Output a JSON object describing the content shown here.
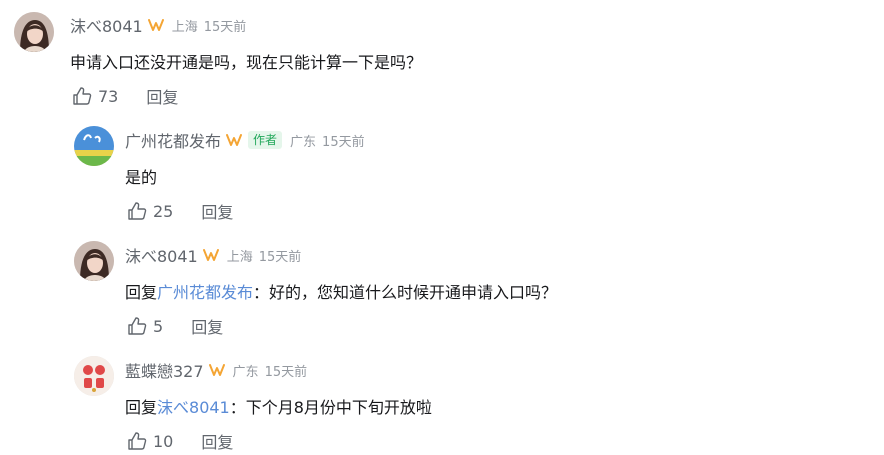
{
  "comments": [
    {
      "username": "沫べ8041",
      "location": "上海",
      "time": "15天前",
      "text": "申请入口还没开通是吗，现在只能计算一下是吗？",
      "likes": "73",
      "reply_label": "回复"
    },
    {
      "username": "广州花都发布",
      "author_tag": "作者",
      "location": "广东",
      "time": "15天前",
      "text": "是的",
      "likes": "25",
      "reply_label": "回复"
    },
    {
      "username": "沫べ8041",
      "location": "上海",
      "time": "15天前",
      "reply_prefix": "回复",
      "reply_to": "广州花都发布",
      "text": "：好的，您知道什么时候开通申请入口吗？",
      "likes": "5",
      "reply_label": "回复"
    },
    {
      "username": "藍蝶戀327",
      "location": "广东",
      "time": "15天前",
      "reply_prefix": "回复",
      "reply_to": "沫べ8041",
      "text": "：下个月8月份中下旬开放啦",
      "likes": "10",
      "reply_label": "回复"
    }
  ],
  "colors": {
    "username": "#61666d",
    "meta": "#9499a0",
    "link": "#5a8bd6",
    "badge": "#f4a534",
    "author_tag_text": "#21a75a",
    "author_tag_bg": "#e5f6eb"
  },
  "icons": {
    "badge": "v-badge-icon",
    "like": "thumbs-up-icon"
  }
}
